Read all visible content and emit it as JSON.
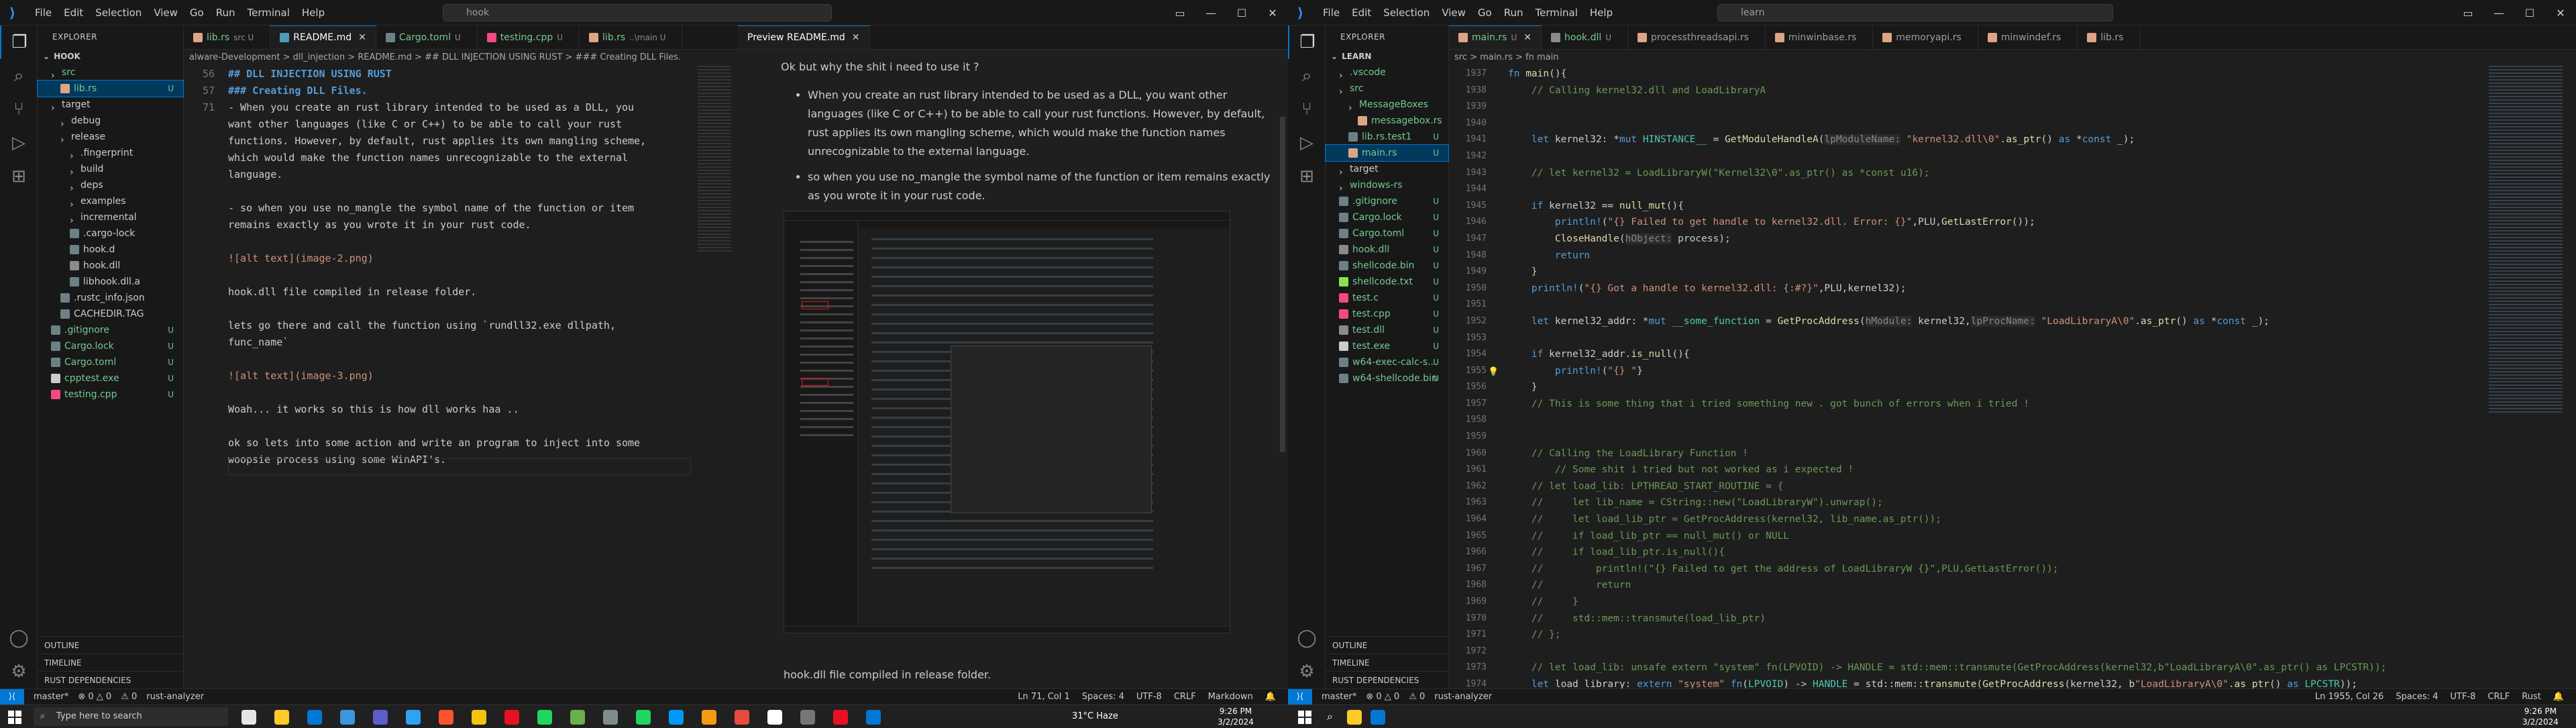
{
  "left": {
    "title_menu": [
      "File",
      "Edit",
      "Selection",
      "View",
      "Go",
      "Run",
      "Terminal",
      "Help"
    ],
    "search": "hook",
    "explorer_label": "EXPLORER",
    "root": "HOOK",
    "tree": [
      {
        "label": "src",
        "depth": 0,
        "kind": "folder",
        "status": "",
        "color": "u"
      },
      {
        "label": "lib.rs",
        "depth": 1,
        "kind": "rs",
        "status": "U",
        "color": "u",
        "selected": true
      },
      {
        "label": "target",
        "depth": 0,
        "kind": "folder",
        "status": "",
        "color": ""
      },
      {
        "label": "debug",
        "depth": 1,
        "kind": "folder",
        "status": "",
        "color": ""
      },
      {
        "label": "release",
        "depth": 1,
        "kind": "folder",
        "status": "",
        "color": ""
      },
      {
        "label": ".fingerprint",
        "depth": 2,
        "kind": "folder",
        "status": "",
        "color": ""
      },
      {
        "label": "build",
        "depth": 2,
        "kind": "folder",
        "status": "",
        "color": ""
      },
      {
        "label": "deps",
        "depth": 2,
        "kind": "folder",
        "status": "",
        "color": ""
      },
      {
        "label": "examples",
        "depth": 2,
        "kind": "folder",
        "status": "",
        "color": ""
      },
      {
        "label": "incremental",
        "depth": 2,
        "kind": "folder",
        "status": "",
        "color": ""
      },
      {
        "label": ".cargo-lock",
        "depth": 2,
        "kind": "cfg",
        "status": "",
        "color": ""
      },
      {
        "label": "hook.d",
        "depth": 2,
        "kind": "cfg",
        "status": "",
        "color": ""
      },
      {
        "label": "hook.dll",
        "depth": 2,
        "kind": "dll",
        "status": "",
        "color": ""
      },
      {
        "label": "libhook.dll.a",
        "depth": 2,
        "kind": "cfg",
        "status": "",
        "color": ""
      },
      {
        "label": ".rustc_info.json",
        "depth": 1,
        "kind": "cfg",
        "status": "",
        "color": ""
      },
      {
        "label": "CACHEDIR.TAG",
        "depth": 1,
        "kind": "cfg",
        "status": "",
        "color": ""
      },
      {
        "label": ".gitignore",
        "depth": 0,
        "kind": "cfg",
        "status": "U",
        "color": "u"
      },
      {
        "label": "Cargo.lock",
        "depth": 0,
        "kind": "cfg",
        "status": "U",
        "color": "u"
      },
      {
        "label": "Cargo.toml",
        "depth": 0,
        "kind": "cfg",
        "status": "U",
        "color": "u"
      },
      {
        "label": "cpptest.exe",
        "depth": 0,
        "kind": "exe",
        "status": "U",
        "color": "u"
      },
      {
        "label": "testing.cpp",
        "depth": 0,
        "kind": "cpp",
        "status": "U",
        "color": "u"
      }
    ],
    "footers": [
      "OUTLINE",
      "TIMELINE",
      "RUST DEPENDENCIES"
    ],
    "tabs": [
      {
        "label": "lib.rs",
        "suffix": "src U",
        "active": false,
        "color": "u"
      },
      {
        "label": "README.md",
        "suffix": "",
        "active": true,
        "color": ""
      },
      {
        "label": "Cargo.toml",
        "suffix": "U",
        "active": false,
        "color": "u"
      },
      {
        "label": "testing.cpp",
        "suffix": "U",
        "active": false,
        "color": "u"
      },
      {
        "label": "lib.rs",
        "suffix": "..\\main U",
        "active": false,
        "color": "u"
      }
    ],
    "preview_tab": "Preview README.md",
    "breadcrumb": "alware-Development > dll_injection > README.md > ## DLL INJECTION USING RUST > ### Creating DLL Files.",
    "line_numbers": [
      "",
      "",
      "",
      "",
      "",
      "",
      "",
      "56",
      "57",
      "",
      "",
      "",
      "",
      "",
      "",
      "",
      "",
      "",
      "",
      "",
      "",
      "",
      "",
      "",
      "",
      "71",
      ""
    ],
    "md_lines": [
      {
        "t": "## DLL INJECTION USING RUST",
        "c": "mdh"
      },
      {
        "t": "### Creating DLL Files.",
        "c": "mdh"
      },
      {
        "t": "- When you create an rust library intended to be used as a DLL, you",
        "c": ""
      },
      {
        "t": "want other languages (like C or C++) to be able to call your rust",
        "c": ""
      },
      {
        "t": "functions. However, by default, rust applies its own mangling scheme,",
        "c": ""
      },
      {
        "t": "which would make the function names unrecognizable to the external",
        "c": ""
      },
      {
        "t": "language.",
        "c": ""
      },
      {
        "t": "",
        "c": ""
      },
      {
        "t": "- so when you use no_mangle the symbol name of the function or item",
        "c": ""
      },
      {
        "t": "remains exactly as you wrote it in your rust code.",
        "c": ""
      },
      {
        "t": "",
        "c": ""
      },
      {
        "t": "![alt text](image-2.png)",
        "c": "mdlink"
      },
      {
        "t": "",
        "c": ""
      },
      {
        "t": "hook.dll file compiled in release folder.",
        "c": ""
      },
      {
        "t": "",
        "c": ""
      },
      {
        "t": "lets go there and call the function using `rundll32.exe dllpath,",
        "c": ""
      },
      {
        "t": "func_name`",
        "c": ""
      },
      {
        "t": "",
        "c": ""
      },
      {
        "t": "![alt text](image-3.png)",
        "c": "mdlink"
      },
      {
        "t": "",
        "c": ""
      },
      {
        "t": "Woah... it works so this is how dll works haa ..",
        "c": ""
      },
      {
        "t": "",
        "c": ""
      },
      {
        "t": "ok so lets into some action and write an program to inject into some",
        "c": ""
      },
      {
        "t": "woopsie process using some WinAPI's.",
        "c": ""
      },
      {
        "t": "",
        "c": ""
      },
      {
        "t": "",
        "c": ""
      }
    ],
    "preview": {
      "question": "Ok but why the shit i need to use it ?",
      "bullet1": "When you create an rust library intended to be used as a DLL, you want other languages (like C or C++) to be able to call your rust functions. However, by default, rust applies its own mangling scheme, which would make the function names unrecognizable to the external language.",
      "bullet2": "so when you use no_mangle the symbol name of the function or item remains exactly as you wrote it in your rust code.",
      "caption": "hook.dll file compiled in release folder."
    },
    "status_left": [
      "master*",
      "⊗ 0 △ 0",
      "⚠ 0",
      "rust-analyzer"
    ],
    "status_right": [
      "Ln 71, Col 1",
      "Spaces: 4",
      "UTF-8",
      "CRLF",
      "Markdown"
    ]
  },
  "right": {
    "title_menu": [
      "File",
      "Edit",
      "Selection",
      "View",
      "Go",
      "Run",
      "Terminal",
      "Help"
    ],
    "search": "learn",
    "explorer_label": "EXPLORER",
    "root": "LEARN",
    "tree": [
      {
        "label": ".vscode",
        "depth": 0,
        "kind": "folder",
        "status": "",
        "color": "u"
      },
      {
        "label": "src",
        "depth": 0,
        "kind": "folder",
        "status": "",
        "color": "u"
      },
      {
        "label": "MessageBoxes",
        "depth": 1,
        "kind": "folder",
        "status": "",
        "color": "u"
      },
      {
        "label": "messagebox.rs",
        "depth": 2,
        "kind": "rs",
        "status": "",
        "color": "u"
      },
      {
        "label": "lib.rs.test1",
        "depth": 1,
        "kind": "cfg",
        "status": "U",
        "color": "u"
      },
      {
        "label": "main.rs",
        "depth": 1,
        "kind": "rs",
        "status": "U",
        "color": "u",
        "selected": true
      },
      {
        "label": "target",
        "depth": 0,
        "kind": "folder",
        "status": "",
        "color": ""
      },
      {
        "label": "windows-rs",
        "depth": 0,
        "kind": "folder",
        "status": "",
        "color": "u"
      },
      {
        "label": ".gitignore",
        "depth": 0,
        "kind": "cfg",
        "status": "U",
        "color": "u"
      },
      {
        "label": "Cargo.lock",
        "depth": 0,
        "kind": "cfg",
        "status": "U",
        "color": "u"
      },
      {
        "label": "Cargo.toml",
        "depth": 0,
        "kind": "cfg",
        "status": "U",
        "color": "u"
      },
      {
        "label": "hook.dll",
        "depth": 0,
        "kind": "dll",
        "status": "U",
        "color": "u"
      },
      {
        "label": "shellcode.bin",
        "depth": 0,
        "kind": "cfg",
        "status": "U",
        "color": "u"
      },
      {
        "label": "shellcode.txt",
        "depth": 0,
        "kind": "txt",
        "status": "U",
        "color": "u"
      },
      {
        "label": "test.c",
        "depth": 0,
        "kind": "cpp",
        "status": "U",
        "color": "u"
      },
      {
        "label": "test.cpp",
        "depth": 0,
        "kind": "cpp",
        "status": "U",
        "color": "u"
      },
      {
        "label": "test.dll",
        "depth": 0,
        "kind": "dll",
        "status": "U",
        "color": "u"
      },
      {
        "label": "test.exe",
        "depth": 0,
        "kind": "exe",
        "status": "U",
        "color": "u"
      },
      {
        "label": "w64-exec-calc-s...",
        "depth": 0,
        "kind": "cfg",
        "status": "U",
        "color": "u"
      },
      {
        "label": "w64-shellcode.bin",
        "depth": 0,
        "kind": "cfg",
        "status": "U",
        "color": "u"
      }
    ],
    "footers": [
      "OUTLINE",
      "TIMELINE",
      "RUST DEPENDENCIES"
    ],
    "tabs": [
      {
        "label": "main.rs",
        "suffix": "U",
        "active": true,
        "color": "u"
      },
      {
        "label": "hook.dll",
        "suffix": "U",
        "active": false,
        "color": "u"
      },
      {
        "label": "processthreadsapi.rs",
        "suffix": "",
        "active": false,
        "color": ""
      },
      {
        "label": "minwinbase.rs",
        "suffix": "",
        "active": false,
        "color": ""
      },
      {
        "label": "memoryapi.rs",
        "suffix": "",
        "active": false,
        "color": ""
      },
      {
        "label": "minwindef.rs",
        "suffix": "",
        "active": false,
        "color": ""
      },
      {
        "label": "lib.rs",
        "suffix": "",
        "active": false,
        "color": ""
      }
    ],
    "breadcrumb": "src > main.rs > fn main",
    "line_numbers": [
      "1937",
      "1938",
      "1939",
      "1940",
      "1941",
      "1942",
      "1943",
      "1944",
      "1945",
      "1946",
      "1947",
      "1948",
      "1949",
      "1950",
      "1951",
      "1952",
      "1953",
      "1954",
      "1955",
      "1956",
      "1957",
      "1958",
      "1959",
      "1960",
      "1961",
      "1962",
      "1963",
      "1964",
      "1965",
      "1966",
      "1967",
      "1968",
      "1969",
      "1970",
      "1971",
      "1972",
      "1973",
      "1974"
    ],
    "code": [
      "fn main(){",
      "    // Calling kernel32.dll and LoadLibraryA",
      "",
      "",
      "    let kernel32: *mut HINSTANCE__ = GetModuleHandleA(lpModuleName: \"kernel32.dll\\0\".as_ptr() as *const _);",
      "",
      "    // let kernel32 = LoadLibraryW(\"Kernel32\\0\".as_ptr() as *const u16);",
      "",
      "    if kernel32 == null_mut(){",
      "        println!(\"{} Failed to get handle to kernel32.dll. Error: {}\",PLU,GetLastError());",
      "        CloseHandle(hObject: process);",
      "        return",
      "    }",
      "    println!(\"{} Got a handle to kernel32.dll: {:#?}\",PLU,kernel32);",
      "",
      "    let kernel32_addr: *mut __some_function = GetProcAddress(hModule: kernel32,lpProcName: \"LoadLibraryA\\0\".as_ptr() as *const _);",
      "",
      "    if kernel32_addr.is_null(){",
      "        println!(\"{} \"}",
      "    }",
      "    // This is some thing that i tried something new . got bunch of errors when i tried !",
      "",
      "",
      "    // Calling the LoadLibrary Function !",
      "        // Some shit i tried but not worked as i expected !",
      "    // let load_lib: LPTHREAD_START_ROUTINE = {",
      "    //     let lib_name = CString::new(\"LoadLibraryW\").unwrap();",
      "    //     let load_lib_ptr = GetProcAddress(kernel32, lib_name.as_ptr());",
      "    //     if load_lib_ptr == null_mut() or NULL",
      "    //     if load_lib_ptr.is_null(){",
      "    //         println!(\"{} Failed to get the address of LoadLibraryW {}\",PLU,GetLastError());",
      "    //         return",
      "    //     }",
      "    //     std::mem::transmute(load_lib_ptr)",
      "    // };",
      "",
      "    // let load_lib: unsafe extern \"system\" fn(LPVOID) -> HANDLE = std::mem::transmute(GetProcAddress(kernel32,b\"LoadLibraryA\\0\".as_ptr() as LPCSTR));",
      "    let load_library: extern \"system\" fn(LPVOID) -> HANDLE = std::mem::transmute(GetProcAddress(kernel32, b\"LoadLibraryA\\0\".as_ptr() as LPCSTR));"
    ],
    "status_left": [
      "master*",
      "⊗ 0 △ 0",
      "⚠ 0",
      "rust-analyzer"
    ],
    "status_right": [
      "Ln 1955, Col 26",
      "Spaces: 4",
      "UTF-8",
      "CRLF",
      "Rust"
    ]
  },
  "taskbar": {
    "search_placeholder": "Type here to search",
    "weather": "31°C  Haze",
    "time_left": "9:26 PM",
    "date_left": "3/2/2024",
    "time_right": "9:26 PM",
    "date_right": "3/2/2024"
  }
}
